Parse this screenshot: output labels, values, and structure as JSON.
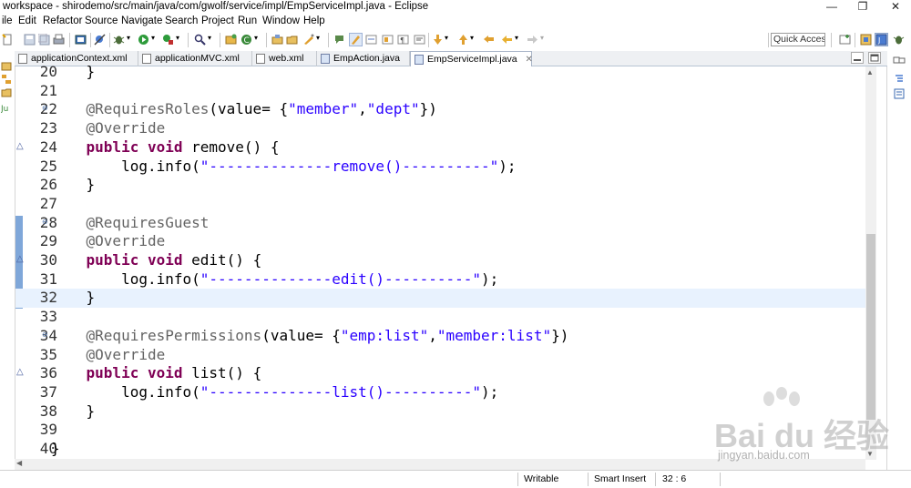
{
  "window": {
    "title": "workspace - shirodemo/src/main/java/com/gwolf/service/impl/EmpServiceImpl.java - Eclipse",
    "controls": {
      "minimize": "—",
      "maximize": "❐",
      "close": "✕"
    }
  },
  "menu": [
    "ile",
    "Edit",
    "Refactor",
    "Source",
    "Navigate",
    "Search",
    "Project",
    "Run",
    "Window",
    "Help"
  ],
  "toolbar": {
    "quick_access_placeholder": "Quick Access"
  },
  "tabs": [
    {
      "label": "applicationContext.xml",
      "icon": "xml-file-icon",
      "active": false
    },
    {
      "label": "applicationMVC.xml",
      "icon": "xml-file-icon",
      "active": false
    },
    {
      "label": "web.xml",
      "icon": "xml-file-icon",
      "active": false
    },
    {
      "label": "EmpAction.java",
      "icon": "java-file-icon",
      "active": false
    },
    {
      "label": "EmpServiceImpl.java",
      "icon": "java-file-icon",
      "active": true,
      "close": "✕"
    }
  ],
  "editor": {
    "current_line": 32,
    "lines": [
      {
        "n": "20",
        "code": [
          {
            "t": "    }",
            "c": ""
          }
        ]
      },
      {
        "n": "21",
        "code": []
      },
      {
        "n": "22",
        "fold": true,
        "code": [
          {
            "t": "    @RequiresRoles",
            "c": "ann"
          },
          {
            "t": "(value= {",
            "c": ""
          },
          {
            "t": "\"member\"",
            "c": "str"
          },
          {
            "t": ",",
            "c": ""
          },
          {
            "t": "\"dept\"",
            "c": "str"
          },
          {
            "t": "})",
            "c": ""
          }
        ]
      },
      {
        "n": "23",
        "code": [
          {
            "t": "    @Override",
            "c": "ann"
          }
        ]
      },
      {
        "n": "24",
        "override": true,
        "code": [
          {
            "t": "    ",
            "c": ""
          },
          {
            "t": "public",
            "c": "kw"
          },
          {
            "t": " ",
            "c": ""
          },
          {
            "t": "void",
            "c": "kw"
          },
          {
            "t": " remove() {",
            "c": ""
          }
        ]
      },
      {
        "n": "25",
        "code": [
          {
            "t": "        log.info(",
            "c": ""
          },
          {
            "t": "\"--------------remove()----------\"",
            "c": "str"
          },
          {
            "t": ");",
            "c": ""
          }
        ]
      },
      {
        "n": "26",
        "code": [
          {
            "t": "    }",
            "c": ""
          }
        ]
      },
      {
        "n": "27",
        "code": []
      },
      {
        "n": "28",
        "fold": true,
        "code": [
          {
            "t": "    @RequiresGuest",
            "c": "ann"
          }
        ]
      },
      {
        "n": "29",
        "code": [
          {
            "t": "    @Override",
            "c": "ann"
          }
        ]
      },
      {
        "n": "30",
        "override": true,
        "code": [
          {
            "t": "    ",
            "c": ""
          },
          {
            "t": "public",
            "c": "kw"
          },
          {
            "t": " ",
            "c": ""
          },
          {
            "t": "void",
            "c": "kw"
          },
          {
            "t": " edit() {",
            "c": ""
          }
        ]
      },
      {
        "n": "31",
        "code": [
          {
            "t": "        log.info(",
            "c": ""
          },
          {
            "t": "\"--------------edit()----------\"",
            "c": "str"
          },
          {
            "t": ");",
            "c": ""
          }
        ]
      },
      {
        "n": "32",
        "code": [
          {
            "t": "    }",
            "c": ""
          }
        ]
      },
      {
        "n": "33",
        "code": []
      },
      {
        "n": "34",
        "fold": true,
        "code": [
          {
            "t": "    @RequiresPermissions",
            "c": "ann"
          },
          {
            "t": "(value= {",
            "c": ""
          },
          {
            "t": "\"emp:list\"",
            "c": "str"
          },
          {
            "t": ",",
            "c": ""
          },
          {
            "t": "\"member:list\"",
            "c": "str"
          },
          {
            "t": "})",
            "c": ""
          }
        ]
      },
      {
        "n": "35",
        "code": [
          {
            "t": "    @Override",
            "c": "ann"
          }
        ]
      },
      {
        "n": "36",
        "override": true,
        "code": [
          {
            "t": "    ",
            "c": ""
          },
          {
            "t": "public",
            "c": "kw"
          },
          {
            "t": " ",
            "c": ""
          },
          {
            "t": "void",
            "c": "kw"
          },
          {
            "t": " list() {",
            "c": ""
          }
        ]
      },
      {
        "n": "37",
        "code": [
          {
            "t": "        log.info(",
            "c": ""
          },
          {
            "t": "\"--------------list()----------\"",
            "c": "str"
          },
          {
            "t": ");",
            "c": ""
          }
        ]
      },
      {
        "n": "38",
        "code": [
          {
            "t": "    }",
            "c": ""
          }
        ]
      },
      {
        "n": "39",
        "code": []
      },
      {
        "n": "40",
        "code": [
          {
            "t": "}",
            "c": ""
          }
        ]
      }
    ]
  },
  "status": {
    "writable": "Writable",
    "insert_mode": "Smart Insert",
    "position": "32 : 6"
  },
  "watermark": {
    "brand": "Bai du 经验",
    "url": "jingyan.baidu.com"
  },
  "colors": {
    "keyword": "#7f0055",
    "annotation": "#646464",
    "string": "#2a00ff",
    "current_line": "#e8f2fe",
    "quick_diff": "#7fa7d9"
  }
}
